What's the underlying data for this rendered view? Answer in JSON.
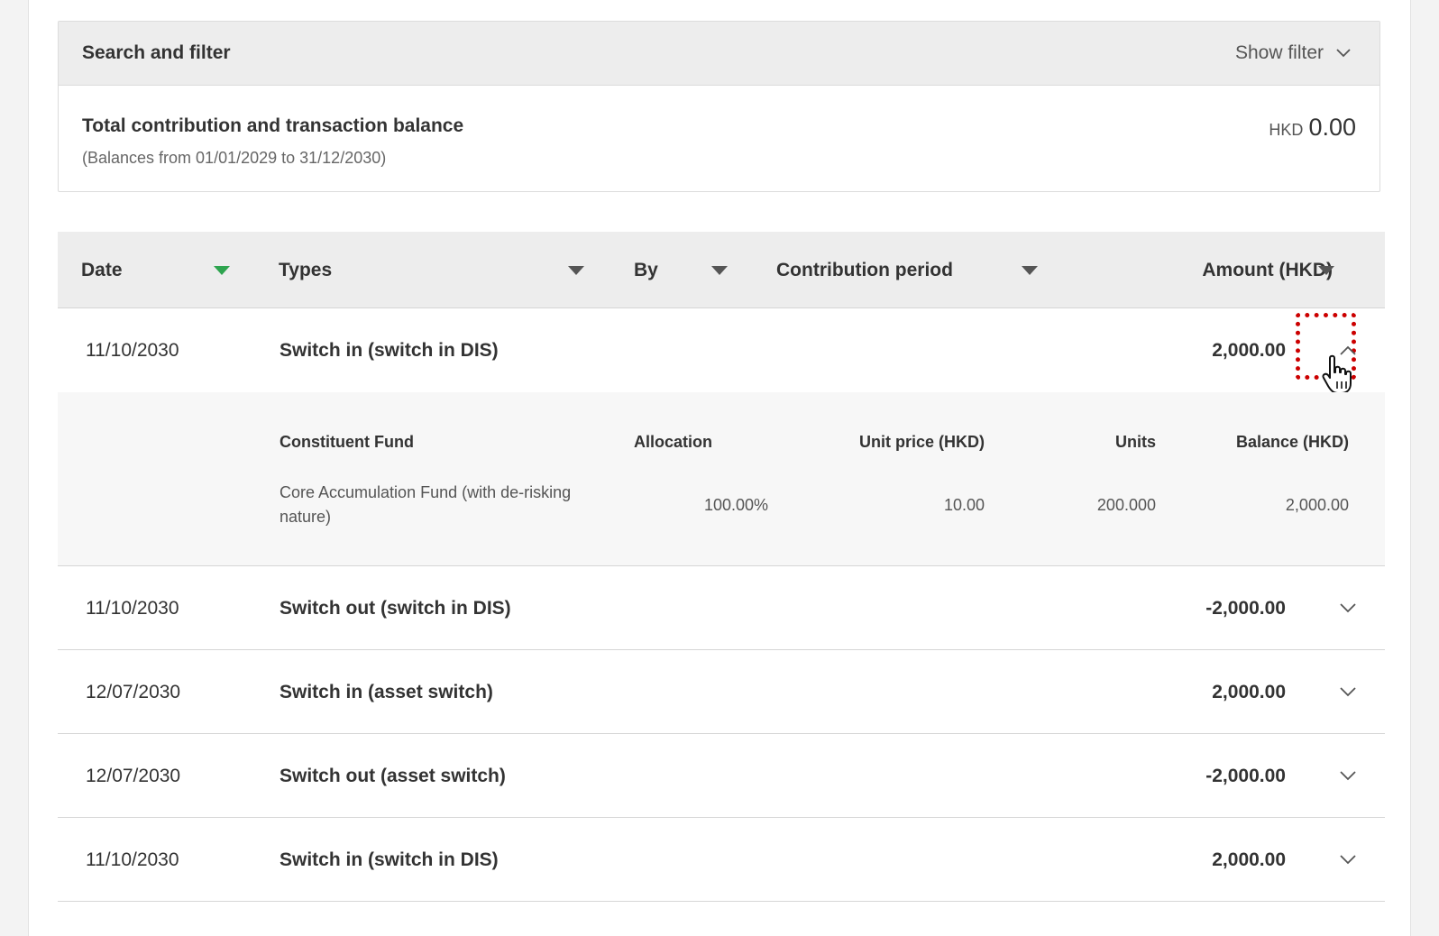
{
  "filter": {
    "title": "Search and filter",
    "toggle_label": "Show filter"
  },
  "balance": {
    "title": "Total contribution and transaction balance",
    "subtitle": "(Balances from 01/01/2029 to 31/12/2030)",
    "currency": "HKD",
    "value": "0.00"
  },
  "table": {
    "headers": {
      "date": "Date",
      "types": "Types",
      "by": "By",
      "period": "Contribution period",
      "amount": "Amount (HKD)"
    },
    "rows": [
      {
        "date": "11/10/2030",
        "type": "Switch in (switch in DIS)",
        "amount": "2,000.00",
        "expanded": true
      },
      {
        "date": "11/10/2030",
        "type": "Switch out (switch in DIS)",
        "amount": "-2,000.00",
        "expanded": false
      },
      {
        "date": "12/07/2030",
        "type": "Switch in (asset switch)",
        "amount": "2,000.00",
        "expanded": false
      },
      {
        "date": "12/07/2030",
        "type": "Switch out (asset switch)",
        "amount": "-2,000.00",
        "expanded": false
      },
      {
        "date": "11/10/2030",
        "type": "Switch in (switch in DIS)",
        "amount": "2,000.00",
        "expanded": false
      }
    ],
    "detail": {
      "headers": {
        "fund": "Constituent Fund",
        "allocation": "Allocation",
        "unit_price": "Unit price (HKD)",
        "units": "Units",
        "balance": "Balance (HKD)"
      },
      "row": {
        "fund_line1": "Core Accumulation Fund (with de-risking",
        "fund_line2": "nature)",
        "allocation": "100.00%",
        "unit_price": "10.00",
        "units": "200.000",
        "balance": "2,000.00"
      }
    }
  },
  "colors": {
    "accent_sort": "#2ea44f",
    "focus_outline": "#cc0000",
    "header_bg": "#ededed",
    "detail_bg": "#f7f7f7"
  },
  "icons": {
    "filter_toggle": "chevron-down-icon",
    "row_expand": "chevron-down-icon",
    "row_collapse": "chevron-up-icon",
    "sort": "caret-down-icon",
    "cursor": "hand-pointer-icon"
  }
}
